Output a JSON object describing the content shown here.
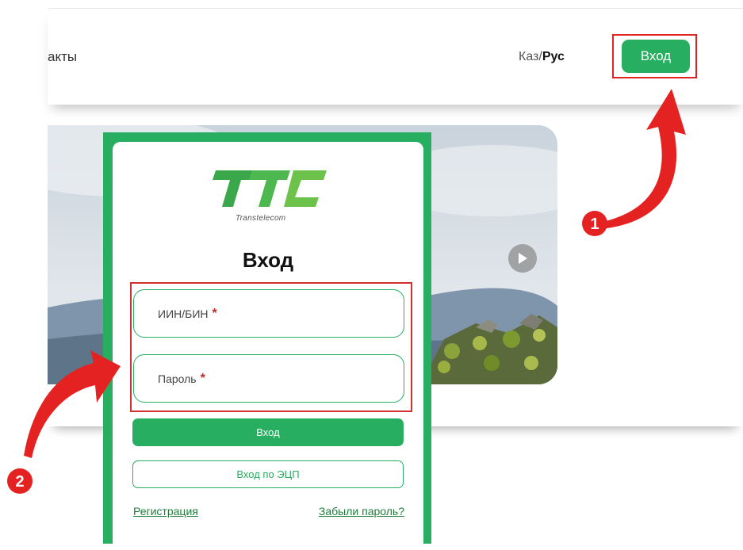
{
  "header": {
    "nav_contacts": "акты",
    "lang_kaz": "Каз/",
    "lang_rus": "Рус",
    "login_button": "Вход"
  },
  "modal": {
    "logo_text": "TTC",
    "logo_subtitle": "Transtelecom",
    "title": "Вход",
    "iin_placeholder": "ИИН/БИН",
    "password_placeholder": "Пароль",
    "required_mark": "*",
    "login_button": "Вход",
    "ecp_button": "Вход по ЭЦП",
    "register_link": "Регистрация",
    "forgot_link": "Забыли пароль?"
  },
  "annotations": {
    "step1": "1",
    "step2": "2"
  },
  "colors": {
    "brand_green": "#27ae60",
    "highlight_red": "#e02424"
  }
}
